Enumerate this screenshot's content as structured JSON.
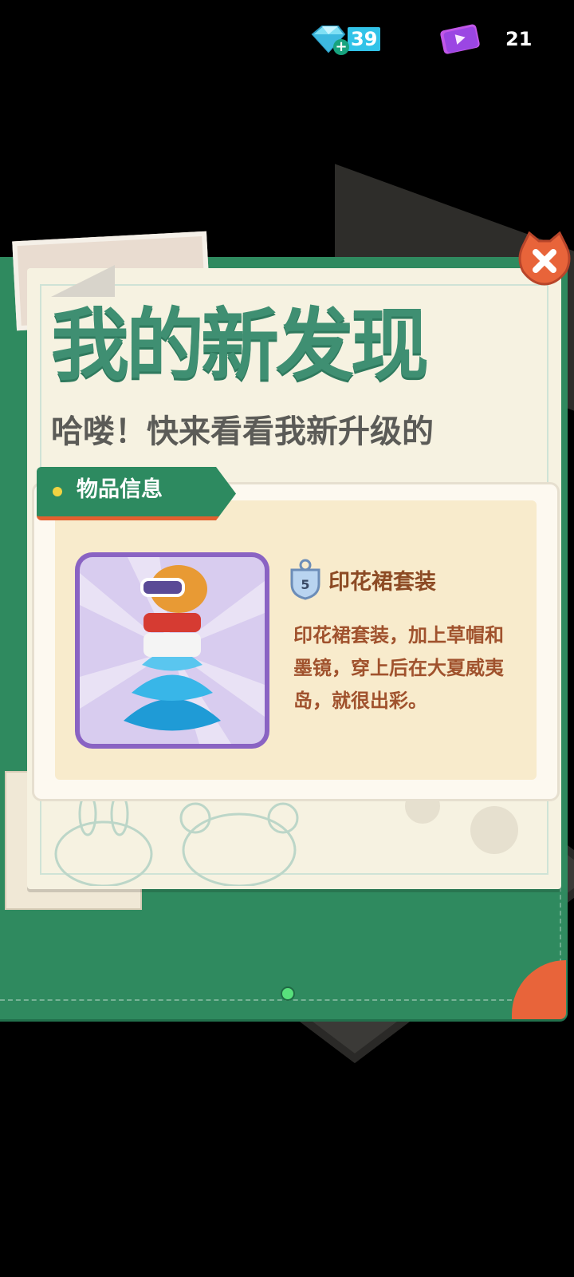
{
  "currency": {
    "gems": {
      "icon": "gem-icon",
      "value": "39"
    },
    "tickets": {
      "icon": "video-ticket-icon",
      "value": "21"
    }
  },
  "popup": {
    "title": "我的新发现",
    "subtitle": "哈喽！快来看看我新升级的",
    "tab_label": "物品信息",
    "item": {
      "level": "5",
      "name": "印花裙套装",
      "description": "印花裙套装，加上草帽和墨镜，穿上后在大夏威夷岛，就很出彩。"
    },
    "page_indicator": {
      "current": 1,
      "total": 1
    }
  },
  "colors": {
    "board_green": "#2f8a5f",
    "title_green": "#3f8f72",
    "accent_orange": "#e8643a",
    "item_text": "#8c4a24",
    "purple_frame": "#8a63c3"
  }
}
